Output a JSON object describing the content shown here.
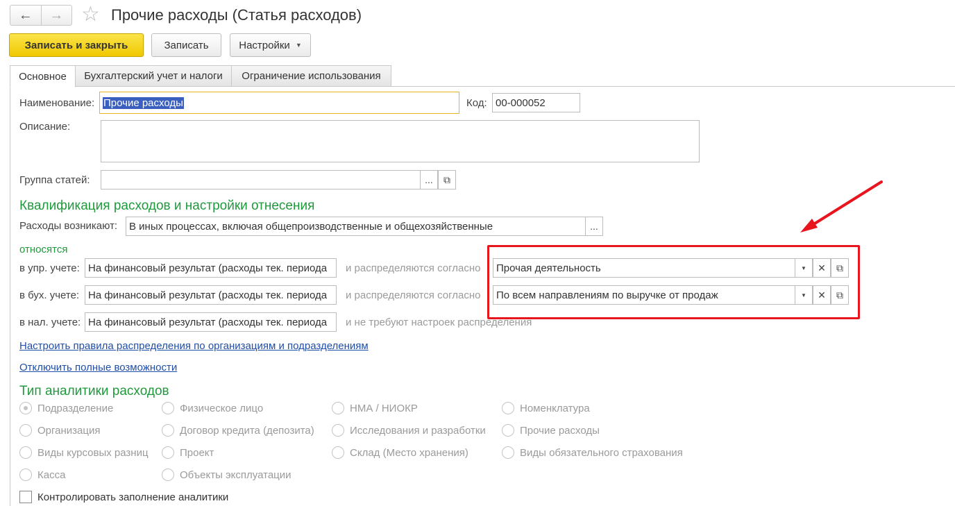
{
  "window": {
    "title": "Прочие расходы (Статья расходов)",
    "back_icon": "←",
    "forward_icon": "→",
    "star_icon": "☆"
  },
  "toolbar": {
    "save_close": "Записать и закрыть",
    "save": "Записать",
    "settings": "Настройки"
  },
  "tabs": [
    {
      "label": "Основное"
    },
    {
      "label": "Бухгалтерский учет и налоги"
    },
    {
      "label": "Ограничение использования"
    }
  ],
  "form": {
    "name_label": "Наименование:",
    "name_value": "Прочие расходы",
    "code_label": "Код:",
    "code_value": "00-000052",
    "desc_label": "Описание:",
    "desc_value": "",
    "group_label": "Группа статей:",
    "group_value": ""
  },
  "qualification": {
    "header": "Квалификация расходов и настройки отнесения",
    "arise_label": "Расходы возникают:",
    "arise_value": "В иных процессах, включая общепроизводственные и общехозяйственные",
    "relate_label": "относятся",
    "rows": [
      {
        "label": "в упр. учете:",
        "value": "На финансовый результат (расходы тек. периода",
        "mid": "и распределяются согласно",
        "dist_value": "Прочая деятельность"
      },
      {
        "label": "в бух. учете:",
        "value": "На финансовый результат (расходы тек. периода",
        "mid": "и распределяются согласно",
        "dist_value": "По всем направлениям по выручке от продаж"
      },
      {
        "label": "в нал. учете:",
        "value": "На финансовый результат (расходы тек. периода",
        "mid": "и не требуют настроек распределения"
      }
    ],
    "link_rules": "Настроить правила распределения по организациям и подразделениям",
    "link_disable": "Отключить полные возможности"
  },
  "analytics": {
    "header": "Тип аналитики расходов",
    "options": [
      [
        "Подразделение",
        "Физическое лицо",
        "НМА / НИОКР",
        "Номенклатура"
      ],
      [
        "Организация",
        "Договор кредита (депозита)",
        "Исследования и разработки",
        "Прочие расходы"
      ],
      [
        "Виды курсовых разниц",
        "Проект",
        "Склад (Место хранения)",
        "Виды обязательного страхования"
      ],
      [
        "Касса",
        "Объекты эксплуатации"
      ]
    ],
    "selected": "Подразделение",
    "check_label": "Контролировать заполнение аналитики",
    "check_value": false
  },
  "colors": {
    "primary_button": "#f0c800",
    "section_green": "#1e9a3c",
    "link_blue": "#1f4ea8",
    "annotation_red": "#e8141e"
  }
}
